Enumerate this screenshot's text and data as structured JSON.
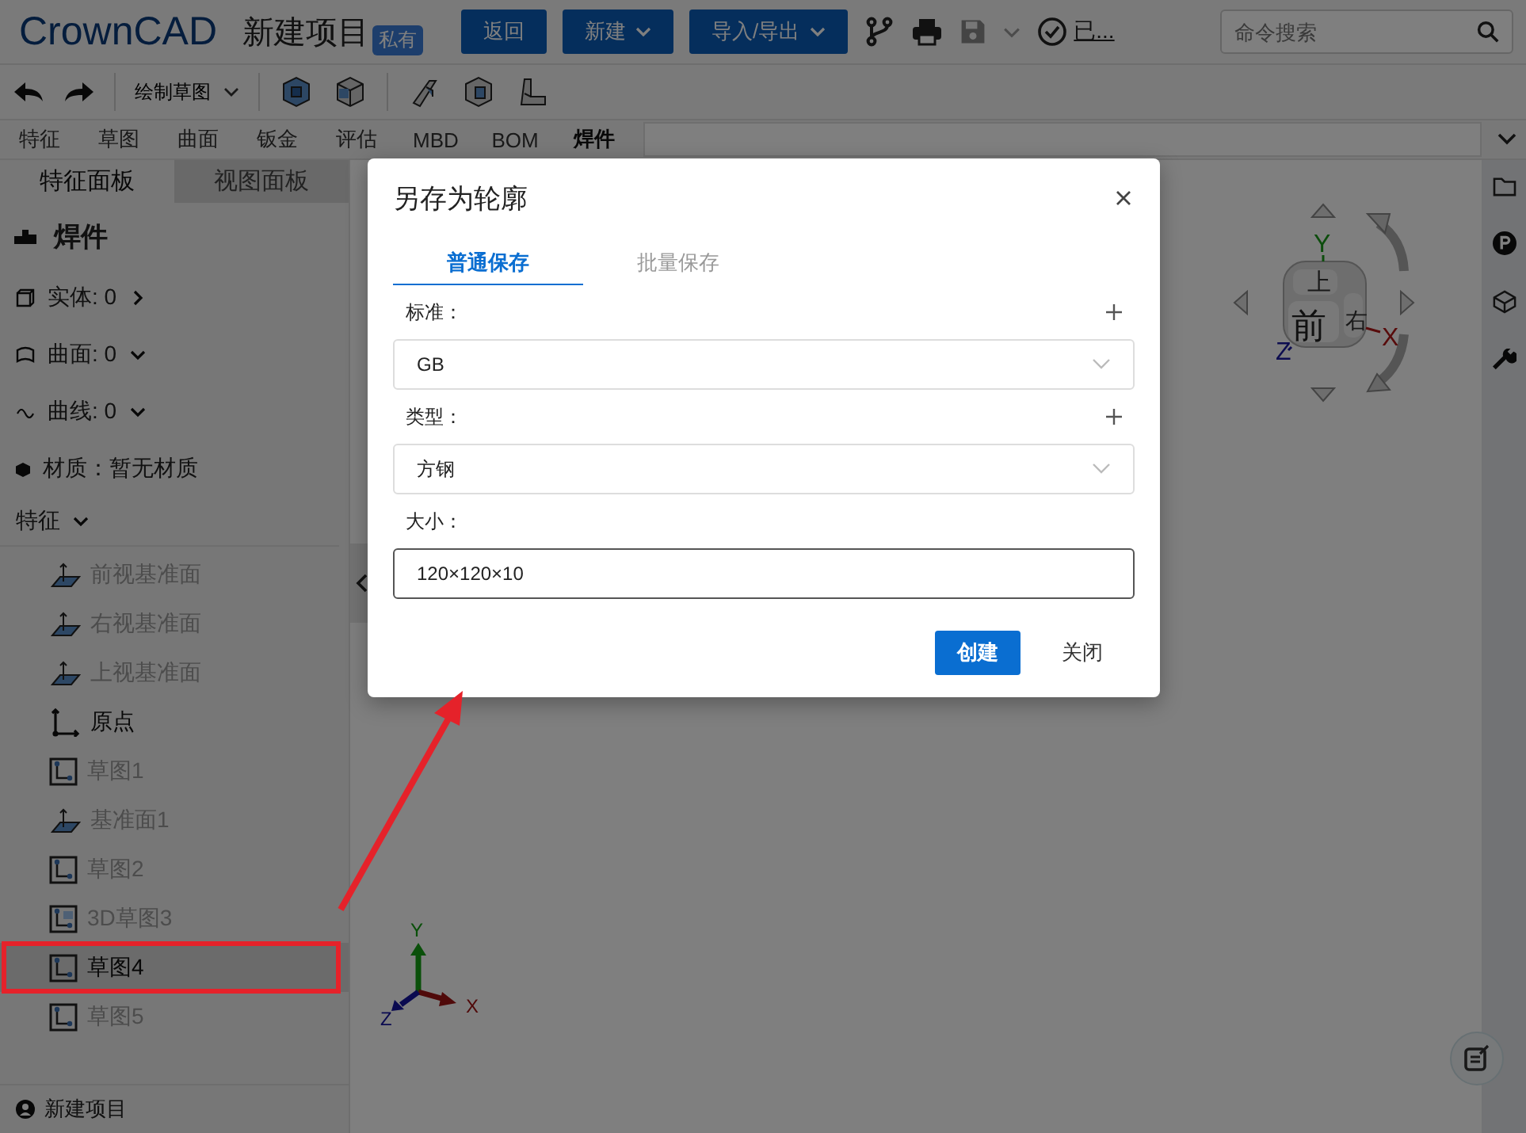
{
  "header": {
    "logo": "CrownCAD",
    "project": "新建项目",
    "badge": "私有",
    "buttons": [
      {
        "label": "返回",
        "dropdown": false
      },
      {
        "label": "新建",
        "dropdown": true
      },
      {
        "label": "导入/导出",
        "dropdown": true
      }
    ],
    "status": "已...",
    "search": {
      "placeholder": "命令搜索"
    }
  },
  "toolbar": {
    "sketch_button": "绘制草图"
  },
  "tabs": [
    {
      "label": "特征",
      "selected": false
    },
    {
      "label": "草图",
      "selected": false
    },
    {
      "label": "曲面",
      "selected": false
    },
    {
      "label": "钣金",
      "selected": false
    },
    {
      "label": "评估",
      "selected": false
    },
    {
      "label": "MBD",
      "selected": false
    },
    {
      "label": "BOM",
      "selected": false
    },
    {
      "label": "焊件",
      "selected": true
    }
  ],
  "panel_tabs": [
    {
      "label": "特征面板",
      "selected": true
    },
    {
      "label": "视图面板",
      "selected": false
    }
  ],
  "weldment": {
    "title": "焊件",
    "rows": [
      {
        "kind": "solid",
        "label": "实体: 0",
        "expanded": false
      },
      {
        "kind": "surface",
        "label": "曲面: 0",
        "expanded": true
      },
      {
        "kind": "curve",
        "label": "曲线: 0",
        "expanded": true
      }
    ],
    "material": "材质：暂无材质"
  },
  "features": {
    "label": "特征",
    "expanded": true,
    "items": [
      {
        "kind": "plane",
        "label": "前视基准面",
        "dimmed": true,
        "selected": false,
        "highlighted": false
      },
      {
        "kind": "plane",
        "label": "右视基准面",
        "dimmed": true,
        "selected": false,
        "highlighted": false
      },
      {
        "kind": "plane",
        "label": "上视基准面",
        "dimmed": true,
        "selected": false,
        "highlighted": false
      },
      {
        "kind": "origin",
        "label": "原点",
        "dimmed": false,
        "selected": false,
        "highlighted": false
      },
      {
        "kind": "sketch",
        "label": "草图1",
        "dimmed": true,
        "selected": false,
        "highlighted": false
      },
      {
        "kind": "plane",
        "label": "基准面1",
        "dimmed": true,
        "selected": false,
        "highlighted": false
      },
      {
        "kind": "sketch",
        "label": "草图2",
        "dimmed": true,
        "selected": false,
        "highlighted": false
      },
      {
        "kind": "sketch3d",
        "label": "3D草图3",
        "dimmed": true,
        "selected": false,
        "highlighted": false
      },
      {
        "kind": "sketch",
        "label": "草图4",
        "dimmed": false,
        "selected": true,
        "highlighted": true
      },
      {
        "kind": "sketch",
        "label": "草图5",
        "dimmed": true,
        "selected": false,
        "highlighted": false
      }
    ]
  },
  "footer": "新建项目",
  "view_cube": {
    "faces": [
      "上",
      "前",
      "右"
    ],
    "axes": [
      "Y",
      "X",
      "Z"
    ]
  },
  "triad": {
    "axes": [
      "Y",
      "X",
      "Z"
    ]
  },
  "dialog": {
    "title": "另存为轮廓",
    "tabs": [
      {
        "label": "普通保存",
        "selected": true
      },
      {
        "label": "批量保存",
        "selected": false
      }
    ],
    "fields": [
      {
        "label": "标准：",
        "kind": "select",
        "value": "GB",
        "addable": true
      },
      {
        "label": "类型：",
        "kind": "select",
        "value": "方钢",
        "addable": true
      },
      {
        "label": "大小：",
        "kind": "input",
        "value": "120×120×10"
      }
    ],
    "buttons": [
      {
        "label": "创建",
        "primary": true
      },
      {
        "label": "关闭",
        "primary": false
      }
    ]
  }
}
